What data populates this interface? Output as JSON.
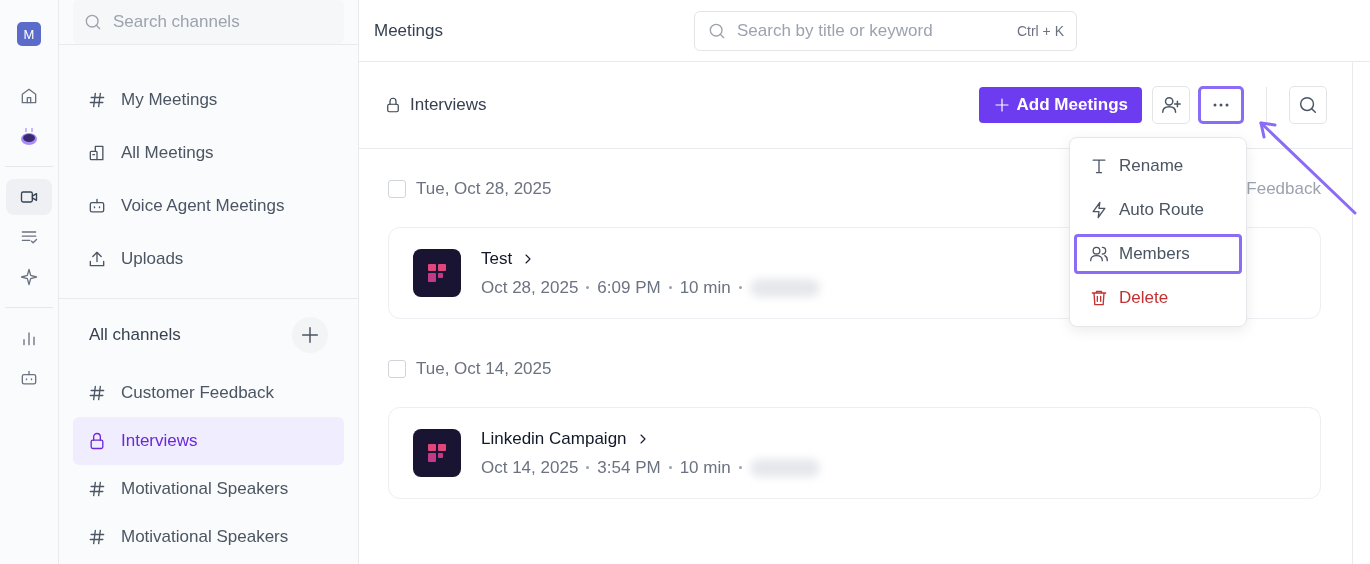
{
  "rail": {
    "avatar": "M",
    "groups": [
      [
        {
          "kind": "home",
          "selected": false
        },
        {
          "kind": "agent",
          "selected": false
        }
      ],
      [
        {
          "kind": "video",
          "selected": true
        },
        {
          "kind": "tasks",
          "selected": false
        },
        {
          "kind": "sparkle",
          "selected": false
        }
      ],
      [
        {
          "kind": "chart",
          "selected": false
        },
        {
          "kind": "bot",
          "selected": false
        }
      ]
    ]
  },
  "sidebar": {
    "search": {
      "placeholder": "Search channels"
    },
    "nav": [
      {
        "label": "My Meetings",
        "kind": "hash"
      },
      {
        "label": "All Meetings",
        "kind": "building"
      },
      {
        "label": "Voice Agent Meetings",
        "kind": "bot"
      },
      {
        "label": "Uploads",
        "kind": "upload"
      }
    ],
    "channels_title": "All channels",
    "channels": [
      {
        "label": "Customer Feedback",
        "kind": "hash",
        "selected": false
      },
      {
        "label": "Interviews",
        "kind": "lock",
        "selected": true
      },
      {
        "label": "Motivational Speakers",
        "kind": "hash",
        "selected": false
      },
      {
        "label": "Motivational Speakers",
        "kind": "hash",
        "selected": false
      }
    ]
  },
  "topbar": {
    "title": "Meetings",
    "search": {
      "placeholder": "Search by title or keyword",
      "shortcut": "Ctrl + K"
    }
  },
  "channel_header": {
    "title": "Interviews",
    "add_button": "Add Meetings",
    "more_highlighted": true
  },
  "menu": [
    {
      "label": "Rename",
      "kind": "rename",
      "highlighted": false
    },
    {
      "label": "Auto Route",
      "kind": "route",
      "highlighted": false
    },
    {
      "label": "Members",
      "kind": "members",
      "highlighted": true
    },
    {
      "label": "Delete",
      "kind": "delete",
      "highlighted": false
    }
  ],
  "groups": [
    {
      "date": "Tue, Oct 28, 2025",
      "checked": false,
      "side_text": "Feedback",
      "meetings": [
        {
          "title": "Test",
          "date": "Oct 28, 2025",
          "time": "6:09 PM",
          "duration": "10 min"
        }
      ]
    },
    {
      "date": "Tue, Oct 14, 2025",
      "checked": false,
      "meetings": [
        {
          "title": "Linkedin Campaign",
          "date": "Oct 14, 2025",
          "time": "3:54 PM",
          "duration": "10 min"
        }
      ]
    }
  ]
}
